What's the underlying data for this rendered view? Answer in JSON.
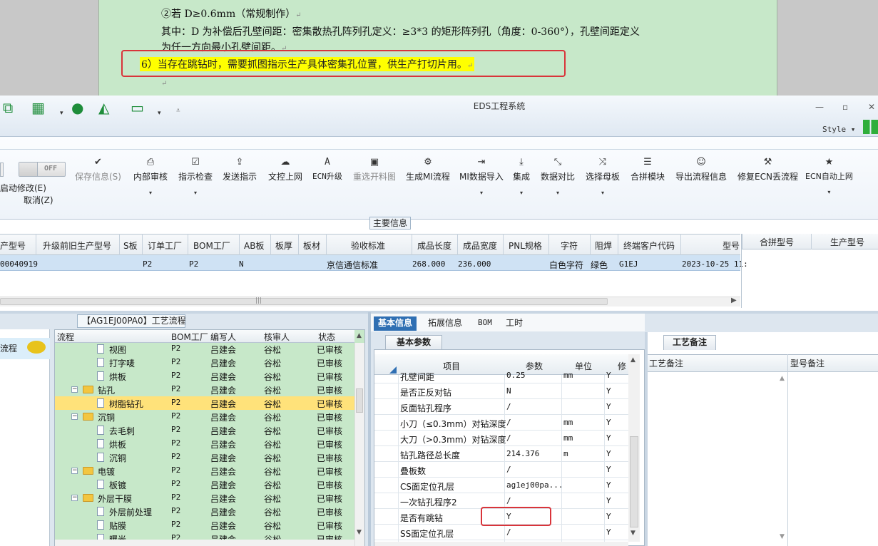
{
  "doc": {
    "line1": "②若 D≥0.6mm（常规制作）",
    "line2": "其中：D 为补偿后孔壁间距：密集散热孔阵列孔定义：≥3*3 的矩形阵列孔（角度：0-360°），孔壁间距定义",
    "line3": "为任一方向最小孔壁间距。",
    "highlight": "6）当存在跳钻时，需要抓图指示生产具体密集孔位置，供生产打切片用。"
  },
  "app": {
    "title": "EDS工程系统",
    "style_label": "Style",
    "qa_icons": [
      "copy-icon",
      "apps-grid-icon",
      "user-icon",
      "area-chart-icon",
      "laptop-icon",
      "customize-icon"
    ]
  },
  "ribbon": {
    "toggle_text": "OFF",
    "start_modify": "启动修改(E)",
    "cancel": "取消(Z)",
    "buttons": [
      {
        "label": "保存信息(S)",
        "icon": "✔",
        "disabled": true
      },
      {
        "label": "内部审核",
        "icon": "🖶"
      },
      {
        "label": "指示检查",
        "icon": "☑"
      },
      {
        "label": "发送指示",
        "icon": "⇪"
      },
      {
        "label": "文控上网",
        "icon": "☁"
      },
      {
        "label": "ECN升级",
        "icon": "A"
      },
      {
        "label": "重选开料图",
        "icon": "▣",
        "disabled": true
      },
      {
        "label": "生成MI流程",
        "icon": "⚙"
      },
      {
        "label": "MI数据导入",
        "icon": "⇥"
      },
      {
        "label": "集成",
        "icon": "⤓"
      },
      {
        "label": "数据对比",
        "icon": "⤡"
      },
      {
        "label": "选择母板",
        "icon": "⤨"
      },
      {
        "label": "合拼模块",
        "icon": "☰"
      },
      {
        "label": "导出流程信息",
        "icon": "☺"
      },
      {
        "label": "修复ECN丢流程",
        "icon": "🔧"
      },
      {
        "label": "ECN自动上网",
        "icon": "★"
      }
    ]
  },
  "main_info": {
    "title": "主要信息",
    "columns": [
      "产型号",
      "升级前旧生产型号",
      "S板",
      "订单工厂",
      "BOM工厂",
      "AB板",
      "板厚",
      "板材",
      "验收标准",
      "成品长度",
      "成品宽度",
      "PNL规格",
      "字符",
      "阻焊",
      "终端客户代码",
      "型号"
    ],
    "row": {
      "model": "00040919",
      "order_factory": "P2",
      "bom_factory": "P2",
      "ab": "N",
      "standard": "京信通信标准",
      "length": "268.000",
      "width": "236.000",
      "char": "白色字符",
      "solder": "绿色",
      "customer": "G1EJ",
      "date": "2023-10-25 11:"
    },
    "right_columns": [
      "合拼型号",
      "生产型号"
    ]
  },
  "process": {
    "title": "【AG1EJ00PA0】工艺流程",
    "left_item": "流程",
    "columns": [
      "流程",
      "BOM工厂",
      "编写人",
      "核审人",
      "状态"
    ],
    "rows": [
      {
        "name": "视图",
        "level": 2,
        "factory": "P2",
        "writer": "吕建会",
        "reviewer": "谷松",
        "status": "已审核"
      },
      {
        "name": "打字唛",
        "level": 2,
        "factory": "P2",
        "writer": "吕建会",
        "reviewer": "谷松",
        "status": "已审核"
      },
      {
        "name": "烘板",
        "level": 2,
        "factory": "P2",
        "writer": "吕建会",
        "reviewer": "谷松",
        "status": "已审核"
      },
      {
        "name": "钻孔",
        "level": 1,
        "factory": "P2",
        "writer": "吕建会",
        "reviewer": "谷松",
        "status": "已审核"
      },
      {
        "name": "树脂钻孔",
        "level": 2,
        "factory": "P2",
        "writer": "吕建会",
        "reviewer": "谷松",
        "status": "已审核",
        "selected": true
      },
      {
        "name": "沉铜",
        "level": 1,
        "factory": "P2",
        "writer": "吕建会",
        "reviewer": "谷松",
        "status": "已审核"
      },
      {
        "name": "去毛刺",
        "level": 2,
        "factory": "P2",
        "writer": "吕建会",
        "reviewer": "谷松",
        "status": "已审核"
      },
      {
        "name": "烘板",
        "level": 2,
        "factory": "P2",
        "writer": "吕建会",
        "reviewer": "谷松",
        "status": "已审核"
      },
      {
        "name": "沉铜",
        "level": 2,
        "factory": "P2",
        "writer": "吕建会",
        "reviewer": "谷松",
        "status": "已审核"
      },
      {
        "name": "电镀",
        "level": 1,
        "factory": "P2",
        "writer": "吕建会",
        "reviewer": "谷松",
        "status": "已审核"
      },
      {
        "name": "板镀",
        "level": 2,
        "factory": "P2",
        "writer": "吕建会",
        "reviewer": "谷松",
        "status": "已审核"
      },
      {
        "name": "外层干膜",
        "level": 1,
        "factory": "P2",
        "writer": "吕建会",
        "reviewer": "谷松",
        "status": "已审核"
      },
      {
        "name": "外层前处理",
        "level": 2,
        "factory": "P2",
        "writer": "吕建会",
        "reviewer": "谷松",
        "status": "已审核"
      },
      {
        "name": "贴膜",
        "level": 2,
        "factory": "P2",
        "writer": "吕建会",
        "reviewer": "谷松",
        "status": "已审核"
      },
      {
        "name": "曝光",
        "level": 2,
        "factory": "P2",
        "writer": "吕建会",
        "reviewer": "谷松",
        "status": "已审核"
      }
    ]
  },
  "basic": {
    "tabs": [
      "基本信息",
      "拓展信息",
      "BOM",
      "工时"
    ],
    "sub_tab": "基本参数",
    "columns": [
      "项目",
      "参数",
      "单位",
      "修"
    ],
    "rows": [
      {
        "item": "孔壁间距",
        "value": "0.25",
        "unit": "mm",
        "flag": "Y"
      },
      {
        "item": "是否正反对钻",
        "value": "N",
        "unit": "",
        "flag": "Y"
      },
      {
        "item": "反面钻孔程序",
        "value": "/",
        "unit": "",
        "flag": "Y"
      },
      {
        "item": "小刀（≤0.3mm）对钻深度",
        "value": "/",
        "unit": "mm",
        "flag": "Y"
      },
      {
        "item": "大刀（>0.3mm）对钻深度",
        "value": "/",
        "unit": "mm",
        "flag": "Y"
      },
      {
        "item": "钻孔路径总长度",
        "value": "214.376",
        "unit": "m",
        "flag": "Y"
      },
      {
        "item": "叠板数",
        "value": "/",
        "unit": "",
        "flag": "Y"
      },
      {
        "item": "CS面定位孔层",
        "value": "ag1ej00pa...",
        "unit": "",
        "flag": "Y"
      },
      {
        "item": "一次钻孔程序2",
        "value": "/",
        "unit": "",
        "flag": "Y"
      },
      {
        "item": "是否有跳钻",
        "value": "Y",
        "unit": "",
        "flag": "Y"
      },
      {
        "item": "SS面定位孔层",
        "value": "/",
        "unit": "",
        "flag": "Y"
      }
    ]
  },
  "notes": {
    "tab": "工艺备注",
    "col1": "工艺备注",
    "col2": "型号备注"
  }
}
